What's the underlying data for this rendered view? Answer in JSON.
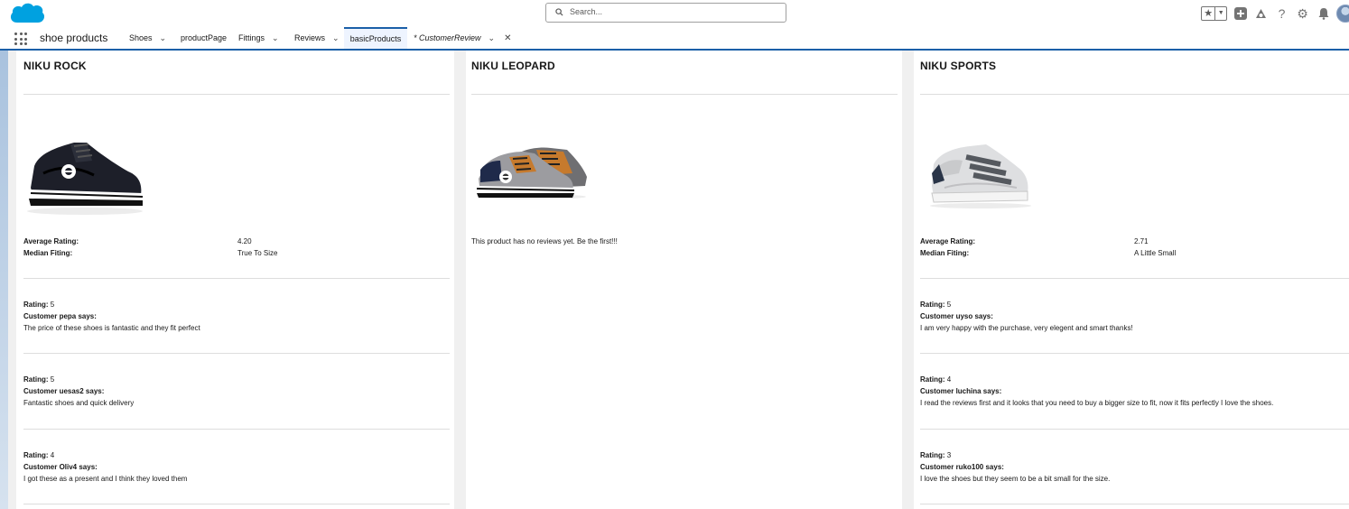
{
  "header": {
    "search_placeholder": "Search...",
    "brand_color": "#00a1e0"
  },
  "nav": {
    "app_name": "shoe products",
    "items": [
      {
        "label": "Shoes",
        "has_menu": true
      },
      {
        "label": "productPage",
        "has_menu": false
      },
      {
        "label": "Fittings",
        "has_menu": true
      },
      {
        "label": "Reviews",
        "has_menu": true
      },
      {
        "label": "basicProducts",
        "has_menu": false,
        "active": true
      },
      {
        "label": "* CustomerReview",
        "has_menu": true,
        "closable": true
      }
    ]
  },
  "products": [
    {
      "name": "NIKU ROCK",
      "image": "black-sneaker",
      "average_rating_label": "Average Rating:",
      "average_rating": "4.20",
      "median_fitting_label": "Median Fiting:",
      "median_fitting": "True To Size",
      "reviews": [
        {
          "rating_label": "Rating:",
          "rating": "5",
          "customer_line": "Customer pepa says:",
          "text": "The price of these shoes is fantastic and they fit perfect"
        },
        {
          "rating_label": "Rating:",
          "rating": "5",
          "customer_line": "Customer uesas2 says:",
          "text": "Fantastic shoes and quick delivery"
        },
        {
          "rating_label": "Rating:",
          "rating": "4",
          "customer_line": "Customer Oliv4 says:",
          "text": "I got these as a present and I think they loved them"
        }
      ]
    },
    {
      "name": "NIKU LEOPARD",
      "image": "grey-orange-sneaker",
      "no_reviews_text": "This product has no reviews yet. Be the first!!!"
    },
    {
      "name": "NIKU SPORTS",
      "image": "silver-velcro-sneaker",
      "average_rating_label": "Average Rating:",
      "average_rating": "2.71",
      "median_fitting_label": "Median Fiting:",
      "median_fitting": "A Little Small",
      "reviews": [
        {
          "rating_label": "Rating:",
          "rating": "5",
          "customer_line": "Customer uyso says:",
          "text": "I am very happy with the purchase, very elegent and smart thanks!"
        },
        {
          "rating_label": "Rating:",
          "rating": "4",
          "customer_line": "Customer luchina says:",
          "text": "I read the reviews first and it looks that you need to buy a bigger size to fit, now it fits perfectly I love the shoes."
        },
        {
          "rating_label": "Rating:",
          "rating": "3",
          "customer_line": "Customer ruko100 says:",
          "text": "I love the shoes but they seem to be a bit small for the size."
        }
      ]
    }
  ]
}
